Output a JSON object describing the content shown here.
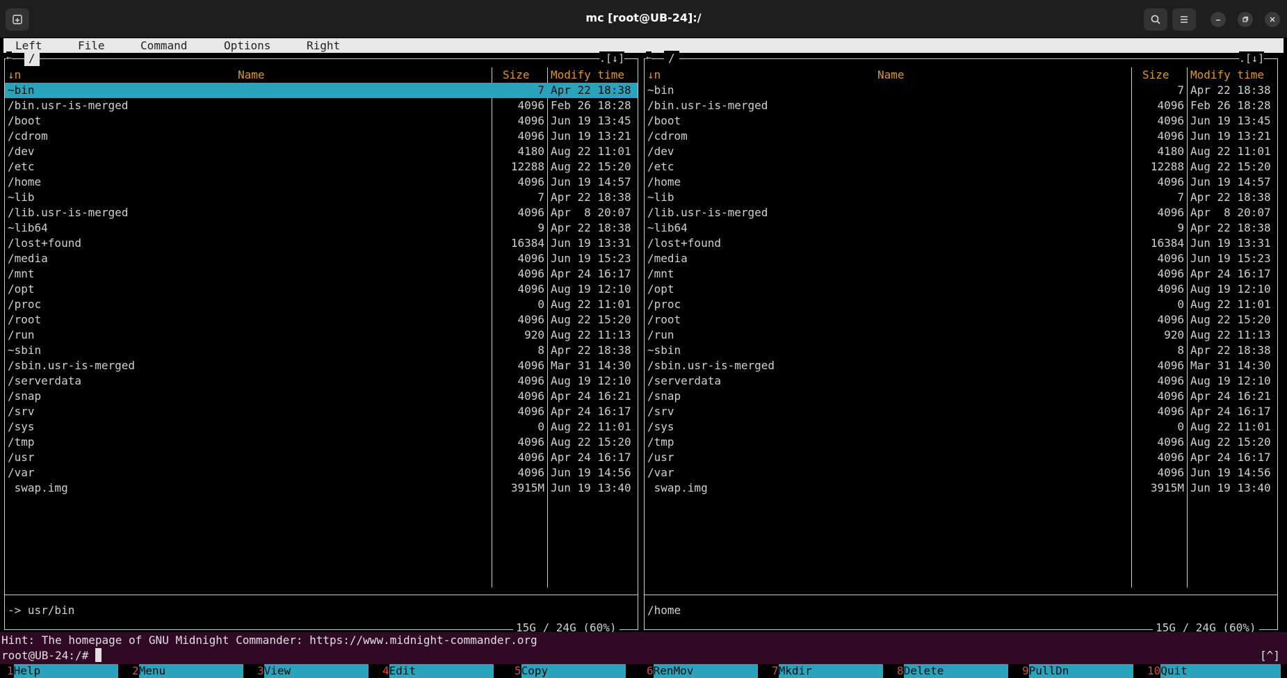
{
  "window": {
    "title": "mc [root@UB-24]:/",
    "colors": {
      "titlebar": "#1e1e1e",
      "panel_bg": "#000000",
      "selection": "#2aa3bd",
      "header": "#e09a1c",
      "hint_bg": "#300a24"
    },
    "icons": [
      "new-tab-icon",
      "search-icon",
      "hamburger-menu-icon",
      "minimize-icon",
      "restore-icon",
      "close-icon"
    ]
  },
  "menubar": [
    "Left",
    "File",
    "Command",
    "Options",
    "Right"
  ],
  "columns": {
    "sort": "↓n",
    "name": "Name",
    "size": "Size",
    "mtime": "Modify time"
  },
  "panels": {
    "left": {
      "path": "/",
      "controls": ".[↓]",
      "status": "-> usr/bin",
      "disk": "15G / 24G (60%)",
      "entries": [
        {
          "name": "~bin",
          "size": "7",
          "date": "Apr 22 18:38"
        },
        {
          "name": "/bin.usr-is-merged",
          "size": "4096",
          "date": "Feb 26 18:28"
        },
        {
          "name": "/boot",
          "size": "4096",
          "date": "Jun 19 13:45"
        },
        {
          "name": "/cdrom",
          "size": "4096",
          "date": "Jun 19 13:21"
        },
        {
          "name": "/dev",
          "size": "4180",
          "date": "Aug 22 11:01"
        },
        {
          "name": "/etc",
          "size": "12288",
          "date": "Aug 22 15:20"
        },
        {
          "name": "/home",
          "size": "4096",
          "date": "Jun 19 14:57"
        },
        {
          "name": "~lib",
          "size": "7",
          "date": "Apr 22 18:38"
        },
        {
          "name": "/lib.usr-is-merged",
          "size": "4096",
          "date": "Apr  8 20:07"
        },
        {
          "name": "~lib64",
          "size": "9",
          "date": "Apr 22 18:38"
        },
        {
          "name": "/lost+found",
          "size": "16384",
          "date": "Jun 19 13:31"
        },
        {
          "name": "/media",
          "size": "4096",
          "date": "Jun 19 15:23"
        },
        {
          "name": "/mnt",
          "size": "4096",
          "date": "Apr 24 16:17"
        },
        {
          "name": "/opt",
          "size": "4096",
          "date": "Aug 19 12:10"
        },
        {
          "name": "/proc",
          "size": "0",
          "date": "Aug 22 11:01"
        },
        {
          "name": "/root",
          "size": "4096",
          "date": "Aug 22 15:20"
        },
        {
          "name": "/run",
          "size": "920",
          "date": "Aug 22 11:13"
        },
        {
          "name": "~sbin",
          "size": "8",
          "date": "Apr 22 18:38"
        },
        {
          "name": "/sbin.usr-is-merged",
          "size": "4096",
          "date": "Mar 31 14:30"
        },
        {
          "name": "/serverdata",
          "size": "4096",
          "date": "Aug 19 12:10"
        },
        {
          "name": "/snap",
          "size": "4096",
          "date": "Apr 24 16:21"
        },
        {
          "name": "/srv",
          "size": "4096",
          "date": "Apr 24 16:17"
        },
        {
          "name": "/sys",
          "size": "0",
          "date": "Aug 22 11:01"
        },
        {
          "name": "/tmp",
          "size": "4096",
          "date": "Aug 22 15:20"
        },
        {
          "name": "/usr",
          "size": "4096",
          "date": "Apr 24 16:17"
        },
        {
          "name": "/var",
          "size": "4096",
          "date": "Jun 19 14:56"
        },
        {
          "name": " swap.img",
          "size": "3915M",
          "date": "Jun 19 13:40"
        }
      ]
    },
    "right": {
      "path": "/",
      "controls": ".[↓]",
      "status": "/home",
      "disk": "15G / 24G (60%)",
      "entries": [
        {
          "name": "~bin",
          "size": "7",
          "date": "Apr 22 18:38"
        },
        {
          "name": "/bin.usr-is-merged",
          "size": "4096",
          "date": "Feb 26 18:28"
        },
        {
          "name": "/boot",
          "size": "4096",
          "date": "Jun 19 13:45"
        },
        {
          "name": "/cdrom",
          "size": "4096",
          "date": "Jun 19 13:21"
        },
        {
          "name": "/dev",
          "size": "4180",
          "date": "Aug 22 11:01"
        },
        {
          "name": "/etc",
          "size": "12288",
          "date": "Aug 22 15:20"
        },
        {
          "name": "/home",
          "size": "4096",
          "date": "Jun 19 14:57"
        },
        {
          "name": "~lib",
          "size": "7",
          "date": "Apr 22 18:38"
        },
        {
          "name": "/lib.usr-is-merged",
          "size": "4096",
          "date": "Apr  8 20:07"
        },
        {
          "name": "~lib64",
          "size": "9",
          "date": "Apr 22 18:38"
        },
        {
          "name": "/lost+found",
          "size": "16384",
          "date": "Jun 19 13:31"
        },
        {
          "name": "/media",
          "size": "4096",
          "date": "Jun 19 15:23"
        },
        {
          "name": "/mnt",
          "size": "4096",
          "date": "Apr 24 16:17"
        },
        {
          "name": "/opt",
          "size": "4096",
          "date": "Aug 19 12:10"
        },
        {
          "name": "/proc",
          "size": "0",
          "date": "Aug 22 11:01"
        },
        {
          "name": "/root",
          "size": "4096",
          "date": "Aug 22 15:20"
        },
        {
          "name": "/run",
          "size": "920",
          "date": "Aug 22 11:13"
        },
        {
          "name": "~sbin",
          "size": "8",
          "date": "Apr 22 18:38"
        },
        {
          "name": "/sbin.usr-is-merged",
          "size": "4096",
          "date": "Mar 31 14:30"
        },
        {
          "name": "/serverdata",
          "size": "4096",
          "date": "Aug 19 12:10"
        },
        {
          "name": "/snap",
          "size": "4096",
          "date": "Apr 24 16:21"
        },
        {
          "name": "/srv",
          "size": "4096",
          "date": "Apr 24 16:17"
        },
        {
          "name": "/sys",
          "size": "0",
          "date": "Aug 22 11:01"
        },
        {
          "name": "/tmp",
          "size": "4096",
          "date": "Aug 22 15:20"
        },
        {
          "name": "/usr",
          "size": "4096",
          "date": "Apr 24 16:17"
        },
        {
          "name": "/var",
          "size": "4096",
          "date": "Jun 19 14:56"
        },
        {
          "name": " swap.img",
          "size": "3915M",
          "date": "Jun 19 13:40"
        }
      ]
    }
  },
  "hint": "Hint: The homepage of GNU Midnight Commander: https://www.midnight-commander.org",
  "prompt": "root@UB-24:/#",
  "scroll_indicator": "[^]",
  "fkeys": [
    {
      "num": "1",
      "label": "Help"
    },
    {
      "num": "2",
      "label": "Menu"
    },
    {
      "num": "3",
      "label": "View"
    },
    {
      "num": "4",
      "label": "Edit"
    },
    {
      "num": "5",
      "label": "Copy"
    },
    {
      "num": "6",
      "label": "RenMov"
    },
    {
      "num": "7",
      "label": "Mkdir"
    },
    {
      "num": "8",
      "label": "Delete"
    },
    {
      "num": "9",
      "label": "PullDn"
    },
    {
      "num": "10",
      "label": "Quit"
    }
  ]
}
